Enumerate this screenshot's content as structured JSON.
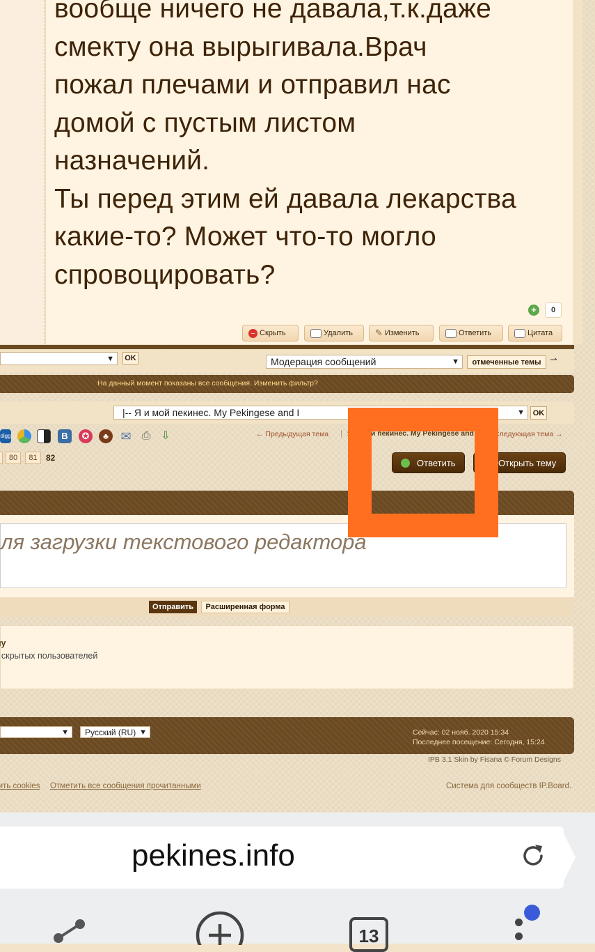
{
  "post": {
    "lines": [
      "вообще ничего не давала,т.к.даже",
      "смекту она вырыгивала.Врач",
      "пожал плечами и отправил нас",
      "домой с пустым листом",
      "назначений.",
      "Ты перед этим ей давала лекарства",
      "какие-то? Может что-то могло",
      "спровоцировать?"
    ],
    "rep_count": "0",
    "buttons": {
      "hide": "Скрыть",
      "delete": "Удалить",
      "edit": "Изменить",
      "reply": "Ответить",
      "quote": "Цитата"
    }
  },
  "moderation": {
    "ok_label": "OK",
    "select_value": "Модерация сообщений",
    "selected_topics": "отмеченные темы"
  },
  "filter_notice": "На данный момент показаны все сообщения. Изменить фильтр?",
  "forum_jump": {
    "value": "|-- Я и мой пекинес. My Pekingese and I",
    "ok_label": "OK"
  },
  "topic_nav": {
    "prev": "← Предыдущая тема",
    "current": "Я и мой пекинес. My Pekingese and I",
    "next": "Следующая тема →"
  },
  "pagination": {
    "pages": [
      "80",
      "81"
    ],
    "current": "82"
  },
  "actions": {
    "reply": "Ответить",
    "new_topic": "Открыть тему"
  },
  "editor": {
    "placeholder": "...для загрузки текстового редактора",
    "submit": "Отправить",
    "advanced": "Расширенная форма"
  },
  "who_reading": {
    "title": "...му",
    "hidden": "... скрытых пользователей"
  },
  "footer": {
    "language": "Русский (RU)",
    "now": "Сейчас: 02 нояб. 2020 15:34",
    "last_visit": "Последнее посещение: Сегодня, 15:24",
    "skin_credit": "IPB 3.1 Skin by Fisana © Forum Designs",
    "cookies_link": "...ить cookies",
    "mark_read": "Отметить все сообщения прочитанными",
    "powered": "Система для сообществ IP.Board."
  },
  "browser": {
    "url": "pekines.info",
    "tab_count": "13"
  },
  "colors": {
    "highlight": "#ff6f1f",
    "brown": "#6b4a22",
    "link": "#a0522d"
  }
}
